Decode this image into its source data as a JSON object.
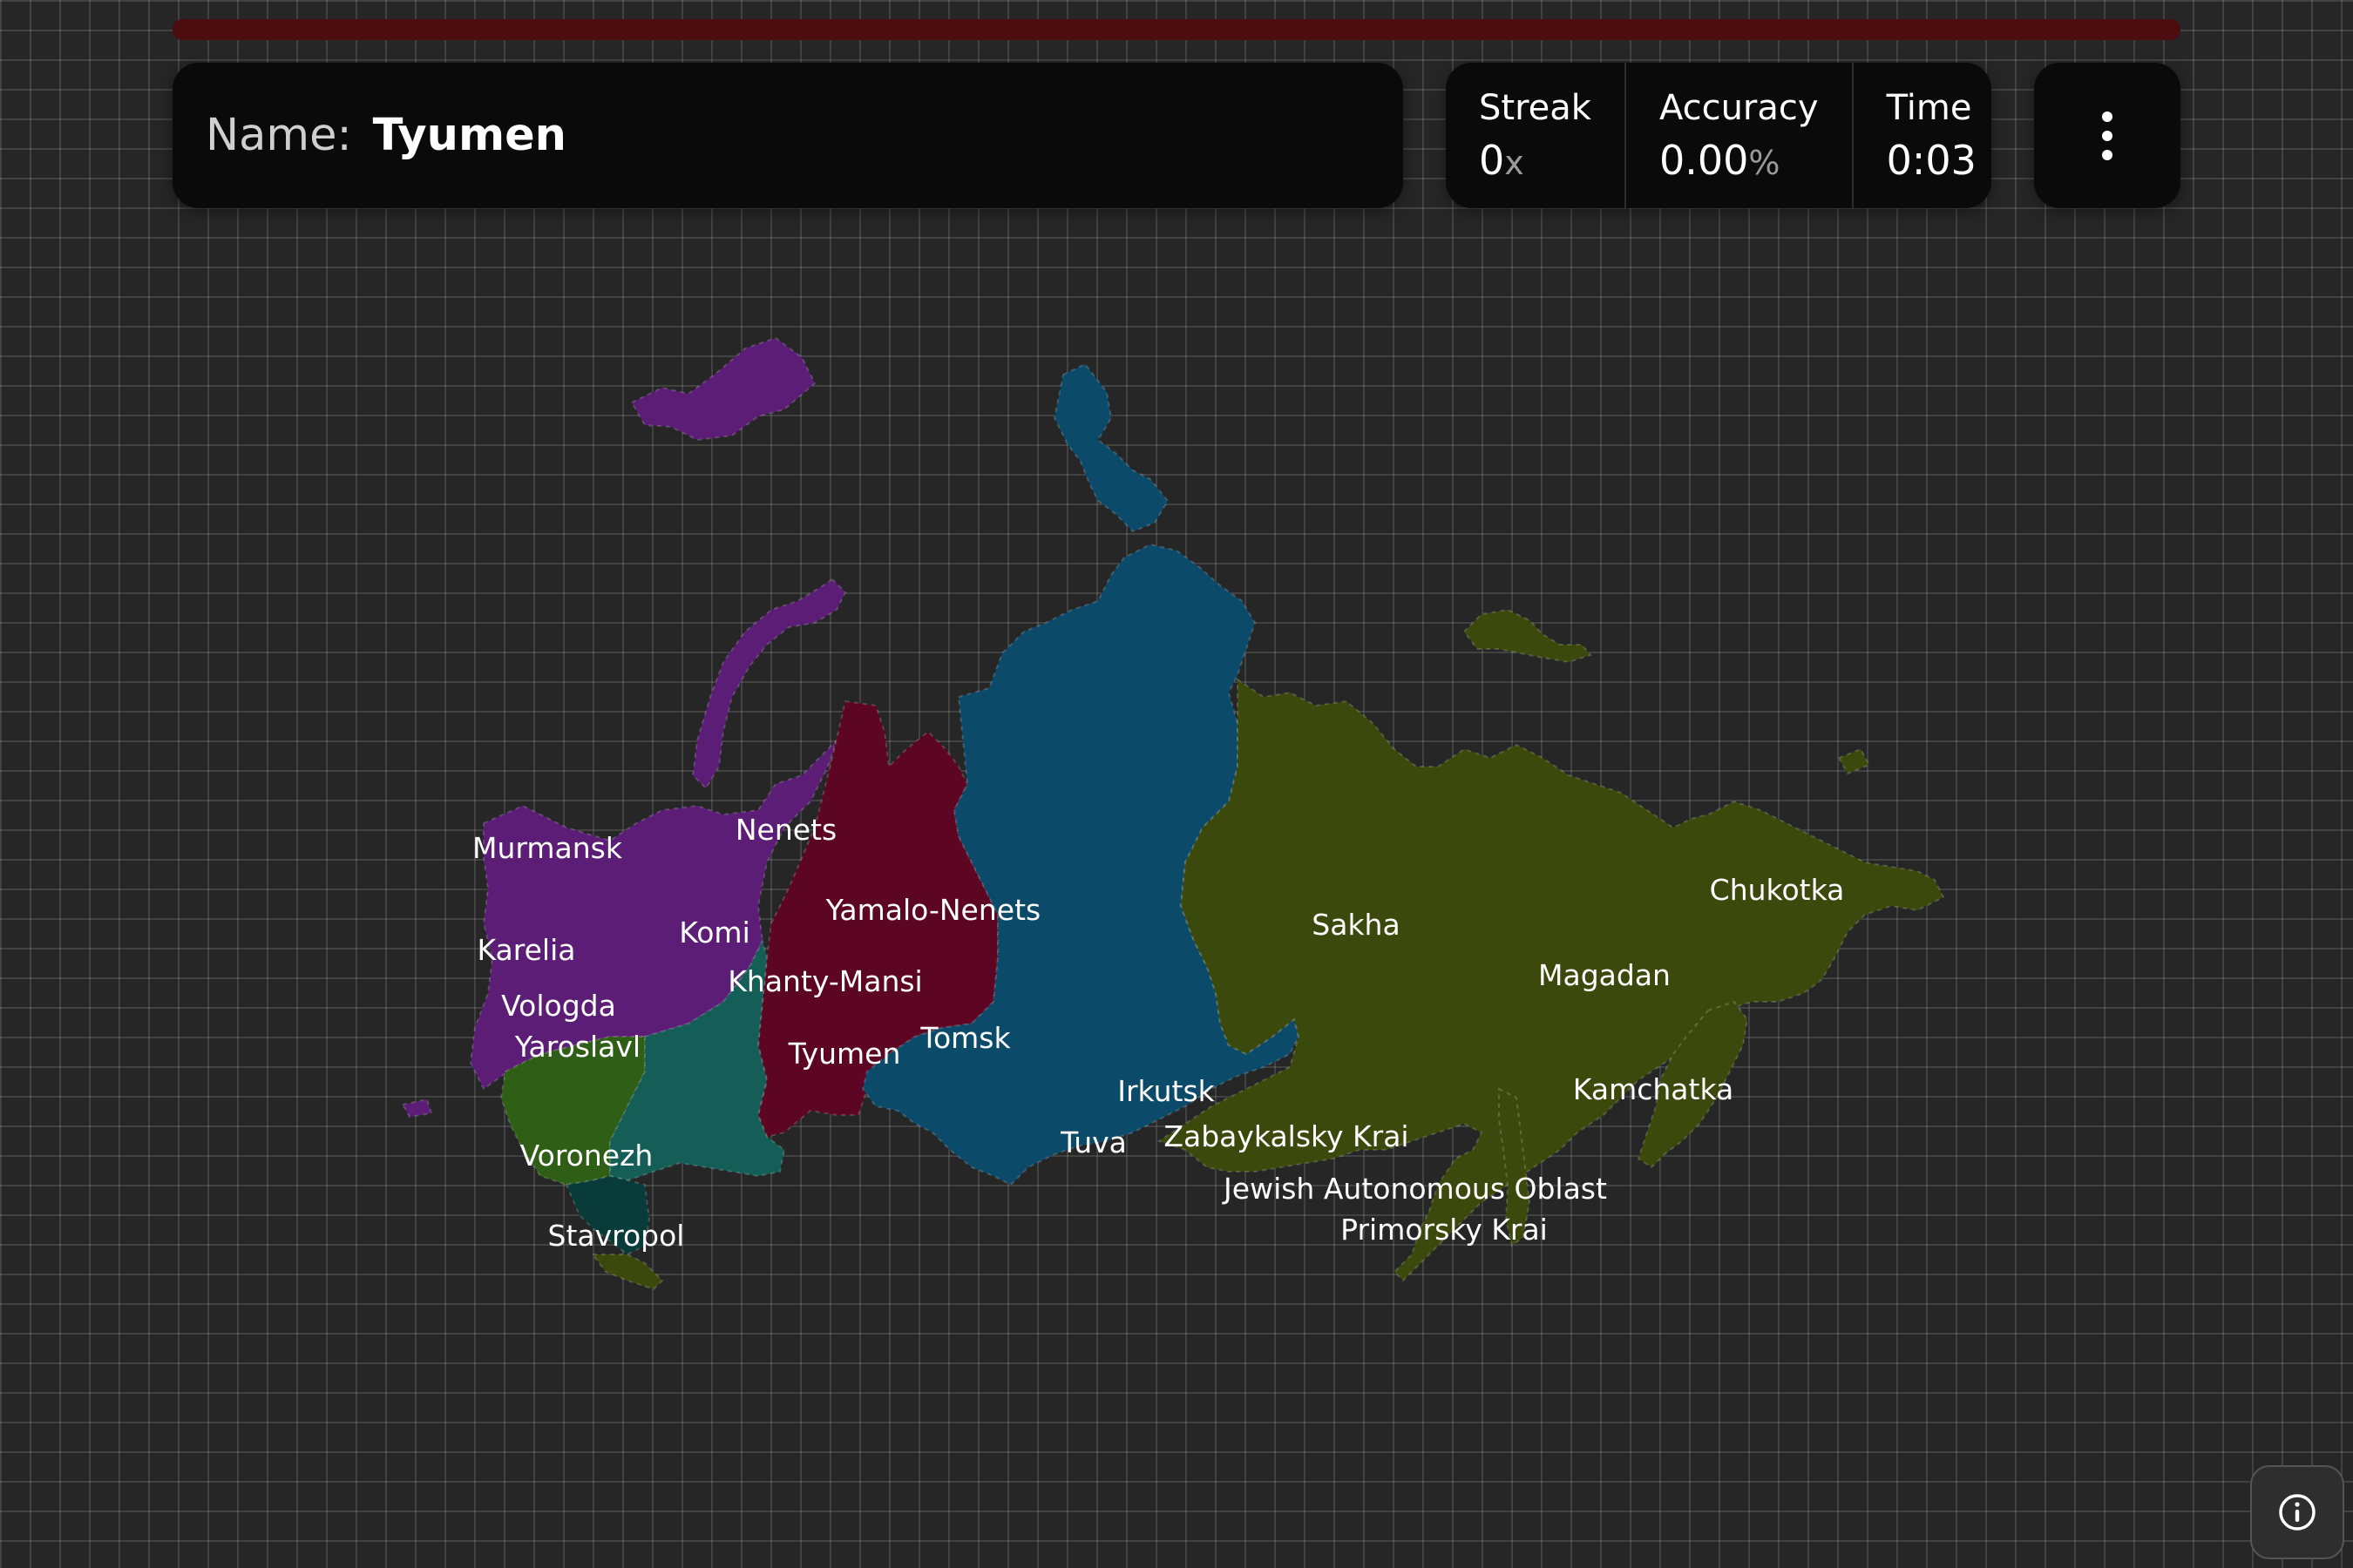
{
  "game": {
    "progress": 1.0,
    "prompt_label": "Name:",
    "prompt_value": "Tyumen"
  },
  "stats": {
    "streak_label": "Streak",
    "streak_value": "0",
    "streak_unit": "x",
    "accuracy_label": "Accuracy",
    "accuracy_value": "0.00",
    "accuracy_unit": "%",
    "time_label": "Time",
    "time_value": "0:03"
  },
  "icons": {
    "menu": "vertical-ellipsis-icon",
    "info": "info-icon"
  },
  "colors": {
    "progress": "#4d0d10",
    "northwest": "#5b1d75",
    "urals": "#5c0623",
    "siberia": "#0c4a6a",
    "far_east": "#3b4a0c",
    "central": "#2f5e16",
    "volga": "#155e58",
    "south": "#093b3a"
  },
  "map": {
    "labels": [
      {
        "id": "murmansk",
        "text": "Murmansk"
      },
      {
        "id": "nenets",
        "text": "Nenets"
      },
      {
        "id": "karelia",
        "text": "Karelia"
      },
      {
        "id": "komi",
        "text": "Komi"
      },
      {
        "id": "yamalo-nenets",
        "text": "Yamalo-Nenets"
      },
      {
        "id": "khanty-mansi",
        "text": "Khanty-Mansi"
      },
      {
        "id": "vologda",
        "text": "Vologda"
      },
      {
        "id": "yaroslavl",
        "text": "Yaroslavl"
      },
      {
        "id": "tyumen",
        "text": "Tyumen"
      },
      {
        "id": "tomsk",
        "text": "Tomsk"
      },
      {
        "id": "voronezh",
        "text": "Voronezh"
      },
      {
        "id": "stavropol",
        "text": "Stavropol"
      },
      {
        "id": "irkutsk",
        "text": "Irkutsk"
      },
      {
        "id": "tuva",
        "text": "Tuva"
      },
      {
        "id": "zabaykalsky",
        "text": "Zabaykalsky Krai"
      },
      {
        "id": "jewish-ao",
        "text": "Jewish Autonomous Oblast"
      },
      {
        "id": "primorsky",
        "text": "Primorsky Krai"
      },
      {
        "id": "sakha",
        "text": "Sakha"
      },
      {
        "id": "magadan",
        "text": "Magadan"
      },
      {
        "id": "kamchatka",
        "text": "Kamchatka"
      },
      {
        "id": "chukotka",
        "text": "Chukotka"
      }
    ]
  }
}
